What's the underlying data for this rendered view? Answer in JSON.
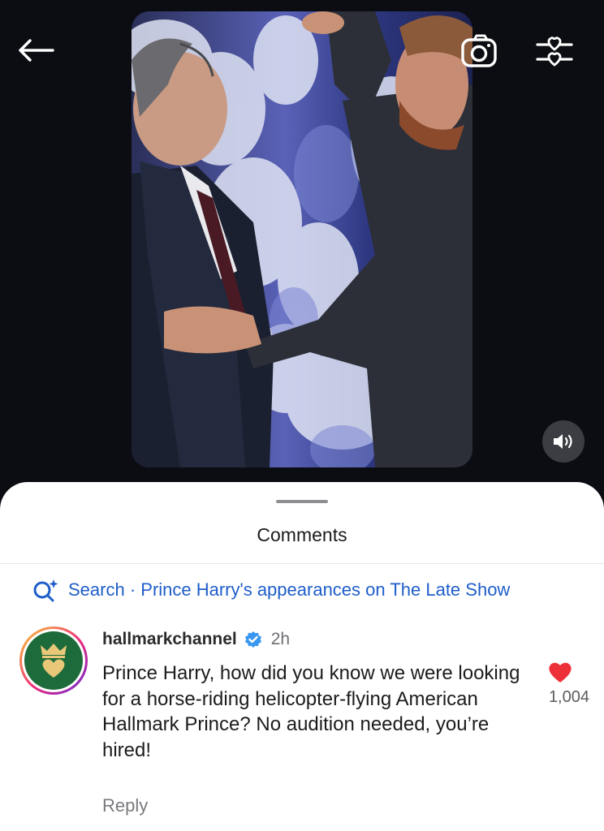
{
  "top_bar": {
    "back_icon": "arrow-left-icon",
    "camera_icon": "camera-icon",
    "filter_icon": "heart-sliders-icon"
  },
  "video": {
    "mute_icon": "speaker-icon"
  },
  "comments_sheet": {
    "title": "Comments",
    "search_prefix": "Search · ",
    "search_query": "Prince Harry's appearances on The Late Show",
    "search_icon": "sparkle-search-icon"
  },
  "comment": {
    "username": "hallmarkchannel",
    "verified": true,
    "time": "2h",
    "text": "Prince Harry, how did you know we were looking for a horse-riding helicopter-flying American Hallmark Prince? No audition needed, you’re hired!",
    "reply_label": "Reply",
    "like_count": "1,004",
    "liked": true
  },
  "colors": {
    "background": "#0b0d12",
    "accent_blue": "#1f5ec9",
    "like_red": "#ed2f3a",
    "verified_blue": "#3897f0",
    "avatar_green": "#1d6b3a"
  }
}
